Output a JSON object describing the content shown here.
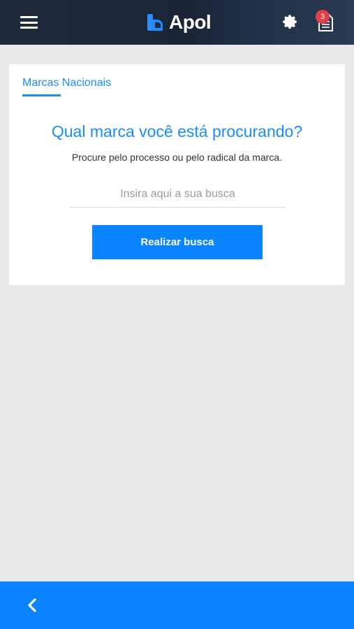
{
  "header": {
    "app_name": "Apol",
    "notification_count": "3",
    "menu_icon": "hamburger-menu-icon",
    "settings_icon": "gear-icon",
    "documents_icon": "document-icon"
  },
  "search_card": {
    "tab_label": "Marcas Nacionais",
    "heading": "Qual marca você está procurando?",
    "subheading": "Procure pelo processo ou pelo radical da marca.",
    "search_placeholder": "Insira aqui a sua busca",
    "search_value": "",
    "submit_label": "Realizar busca"
  },
  "footer": {
    "back_icon": "chevron-left-icon"
  },
  "colors": {
    "accent": "#0a84ff",
    "header_bg": "#1f2b3d",
    "badge": "#e0404a",
    "background": "#e9e9e9"
  }
}
